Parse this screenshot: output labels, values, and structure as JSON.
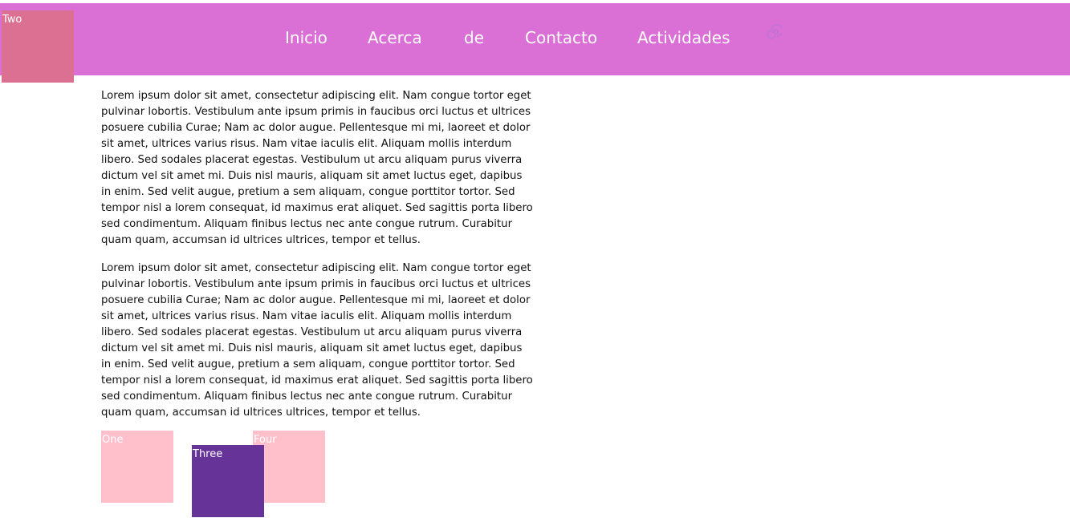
{
  "nav": {
    "items": [
      {
        "label": "Inicio"
      },
      {
        "label": "Acerca"
      },
      {
        "label": "de"
      },
      {
        "label": "Contacto"
      },
      {
        "label": "Actividades"
      }
    ]
  },
  "boxes": {
    "two": "Two",
    "one": "One",
    "three": "Three",
    "four": "Four"
  },
  "content": {
    "paragraphs": [
      "Lorem ipsum dolor sit amet, consectetur adipiscing elit. Nam congue tortor eget pulvinar lobortis. Vestibulum ante ipsum primis in faucibus orci luctus et ultrices posuere cubilia Curae; Nam ac dolor augue. Pellentesque mi mi, laoreet et dolor sit amet, ultrices varius risus. Nam vitae iaculis elit. Aliquam mollis interdum libero. Sed sodales placerat egestas. Vestibulum ut arcu aliquam purus viverra dictum vel sit amet mi. Duis nisl mauris, aliquam sit amet luctus eget, dapibus in enim. Sed velit augue, pretium a sem aliquam, congue porttitor tortor. Sed tempor nisl a lorem consequat, id maximus erat aliquet. Sed sagittis porta libero sed condimentum. Aliquam finibus lectus nec ante congue rutrum. Curabitur quam quam, accumsan id ultrices ultrices, tempor et tellus.",
      "Lorem ipsum dolor sit amet, consectetur adipiscing elit. Nam congue tortor eget pulvinar lobortis. Vestibulum ante ipsum primis in faucibus orci luctus et ultrices posuere cubilia Curae; Nam ac dolor augue. Pellentesque mi mi, laoreet et dolor sit amet, ultrices varius risus. Nam vitae iaculis elit. Aliquam mollis interdum libero. Sed sodales placerat egestas. Vestibulum ut arcu aliquam purus viverra dictum vel sit amet mi. Duis nisl mauris, aliquam sit amet luctus eget, dapibus in enim. Sed velit augue, pretium a sem aliquam, congue porttitor tortor. Sed tempor nisl a lorem consequat, id maximus erat aliquet. Sed sagittis porta libero sed condimentum. Aliquam finibus lectus nec ante congue rutrum. Curabitur quam quam, accumsan id ultrices ultrices, tempor et tellus."
    ]
  },
  "icons": {
    "nav_icon": "spiral-icon"
  },
  "colors": {
    "header_bg": "#da70d6",
    "box_two": "#db7093",
    "box_pink": "#ffc0cb",
    "box_three": "#663399"
  }
}
